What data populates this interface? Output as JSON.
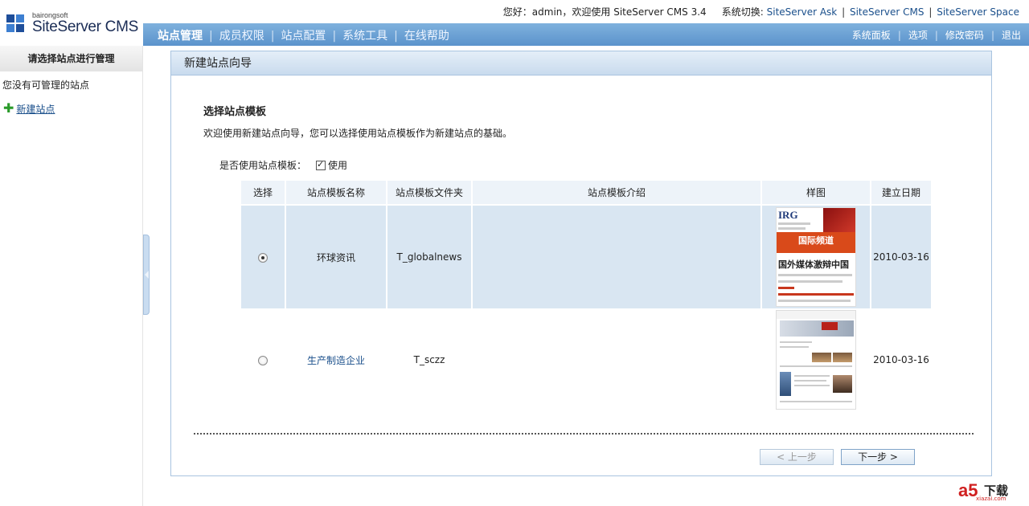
{
  "logo": {
    "small": "bairongsoft",
    "big": "SiteServer CMS"
  },
  "top": {
    "greeting": "您好：admin，欢迎使用 SiteServer CMS 3.4",
    "switch_label": "系统切换:",
    "links": [
      "SiteServer Ask",
      "SiteServer CMS",
      "SiteServer Space"
    ]
  },
  "nav": {
    "items": [
      "站点管理",
      "成员权限",
      "站点配置",
      "系统工具",
      "在线帮助"
    ],
    "right": [
      "系统面板",
      "选项",
      "修改密码",
      "退出"
    ]
  },
  "sidebar": {
    "header": "请选择站点进行管理",
    "empty": "您没有可管理的站点",
    "add_link": "新建站点"
  },
  "panel": {
    "title": "新建站点向导",
    "section_title": "选择站点模板",
    "description": "欢迎使用新建站点向导，您可以选择使用站点模板作为新建站点的基础。",
    "use_template_label": "是否使用站点模板：",
    "use_template_checkbox": "使用",
    "use_template_checked": true,
    "columns": [
      "选择",
      "站点模板名称",
      "站点模板文件夹",
      "站点模板介绍",
      "样图",
      "建立日期"
    ],
    "rows": [
      {
        "name": "环球资讯",
        "folder": "T_globalnews",
        "intro": "",
        "date": "2010-03-16",
        "selected": true
      },
      {
        "name": "生产制造企业",
        "folder": "T_sczz",
        "intro": "",
        "date": "2010-03-16",
        "selected": false
      }
    ],
    "thumb1": {
      "logo": "IRG",
      "band": "国际频道",
      "headline": "国外媒体激辩中国"
    },
    "prev_button": "< 上一步",
    "next_button": "下一步 >"
  },
  "watermark": {
    "brand": "a5",
    "text": "下载",
    "url": "xiazai.com"
  }
}
